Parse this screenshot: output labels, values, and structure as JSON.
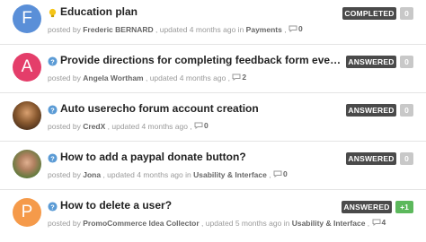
{
  "topics": [
    {
      "title": "Education plan",
      "type_icon": "lightbulb-icon",
      "avatar_letter": "F",
      "avatar_color": "#5a8fd8",
      "meta_prefix": "posted by ",
      "author": "Frederic BERNARD",
      "meta_middle": " , updated 4 months ago in ",
      "category": "Payments",
      "comment_sep": " , ",
      "comments": "0",
      "status": "COMPLETED",
      "status_color": "#4a4a4a",
      "votes": "0"
    },
    {
      "title": "Provide directions for completing feedback form even if not si...",
      "type_icon": "question-icon",
      "avatar_letter": "A",
      "avatar_color": "#e43e6a",
      "meta_prefix": "posted by ",
      "author": "Angela Wortham",
      "meta_middle": " , updated 4 months ago , ",
      "category": "",
      "comment_sep": "",
      "comments": "2",
      "status": "ANSWERED",
      "status_color": "#4a4a4a",
      "votes": "0"
    },
    {
      "title": "Auto userecho forum account creation",
      "type_icon": "question-icon",
      "avatar_letter": "",
      "avatar_color": "#6b4a2a",
      "meta_prefix": "posted by ",
      "author": "CredX",
      "meta_middle": " , updated 4 months ago , ",
      "category": "",
      "comment_sep": "",
      "comments": "0",
      "status": "ANSWERED",
      "status_color": "#4a4a4a",
      "votes": "0"
    },
    {
      "title": "How to add a paypal donate button?",
      "type_icon": "question-icon",
      "avatar_letter": "",
      "avatar_color": "#7a8a5a",
      "meta_prefix": "posted by ",
      "author": "Jona",
      "meta_middle": " , updated 4 months ago in ",
      "category": "Usability & Interface",
      "comment_sep": " , ",
      "comments": "0",
      "status": "ANSWERED",
      "status_color": "#4a4a4a",
      "votes": "0"
    },
    {
      "title": "How to delete a user?",
      "type_icon": "question-icon",
      "avatar_letter": "P",
      "avatar_color": "#f59a4a",
      "meta_prefix": "posted by ",
      "author": "PromoCommerce Idea Collector",
      "meta_middle": " , updated 5 months ago in ",
      "category": "Usability & Interface",
      "comment_sep": " , ",
      "comments": "4",
      "status": "ANSWERED",
      "status_color": "#4a4a4a",
      "votes": "+1"
    }
  ]
}
